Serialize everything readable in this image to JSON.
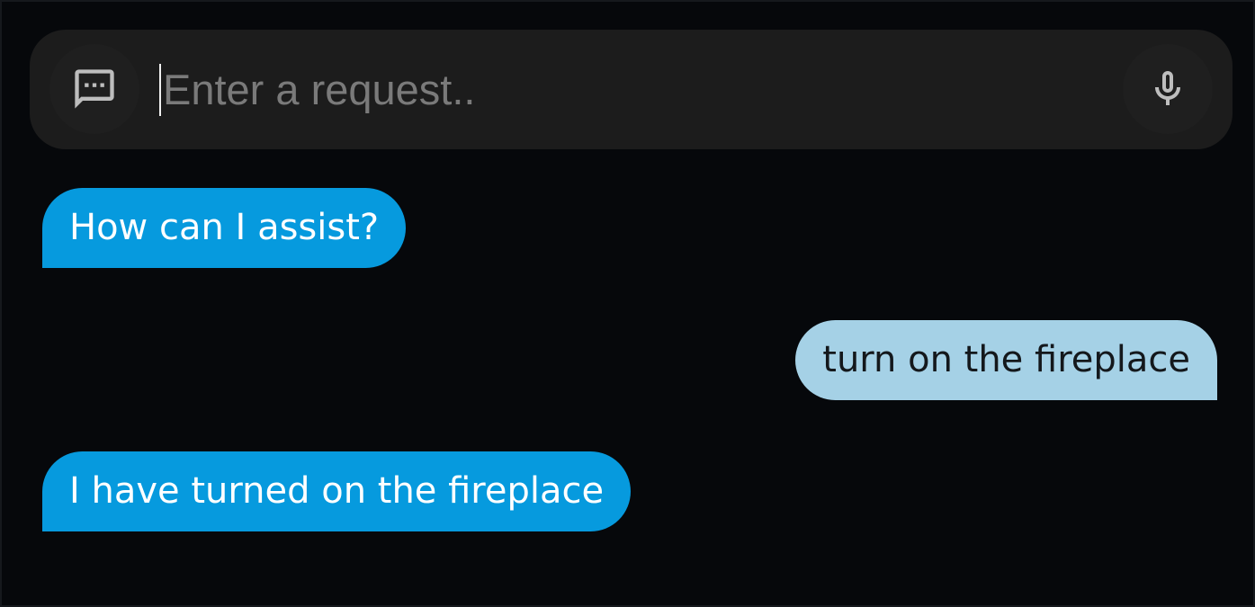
{
  "request_bar": {
    "placeholder": "Enter a request..",
    "value": "",
    "left_icon": "chat-bubble-dots-icon",
    "right_icon": "microphone-icon"
  },
  "messages": [
    {
      "role": "assistant",
      "text": "How can I assist?"
    },
    {
      "role": "user",
      "text": "turn on the fireplace"
    },
    {
      "role": "assistant",
      "text": "I have turned on the fireplace"
    }
  ],
  "colors": {
    "background": "#06080b",
    "request_bar": "#1c1c1c",
    "assistant_bubble": "#069ade",
    "user_bubble": "#a5d1e6",
    "icon": "#bdbdbd",
    "placeholder": "#7a7a7a"
  }
}
